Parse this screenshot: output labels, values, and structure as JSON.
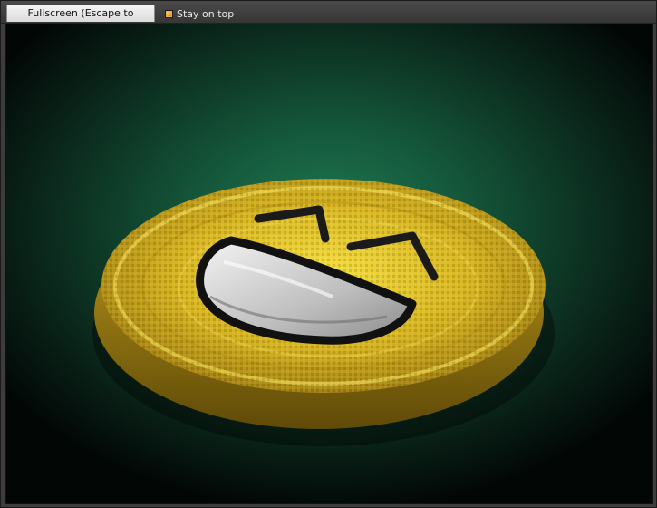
{
  "toolbar": {
    "fullscreen_label": "Fullscreen (Escape to restore)",
    "stay_on_top_label": "Stay on top",
    "stay_on_top_checked": true
  },
  "scene": {
    "object": "yellow-coin-with-laughing-face",
    "background_color": "#1f7a52",
    "coin_color": "#e0c020"
  }
}
